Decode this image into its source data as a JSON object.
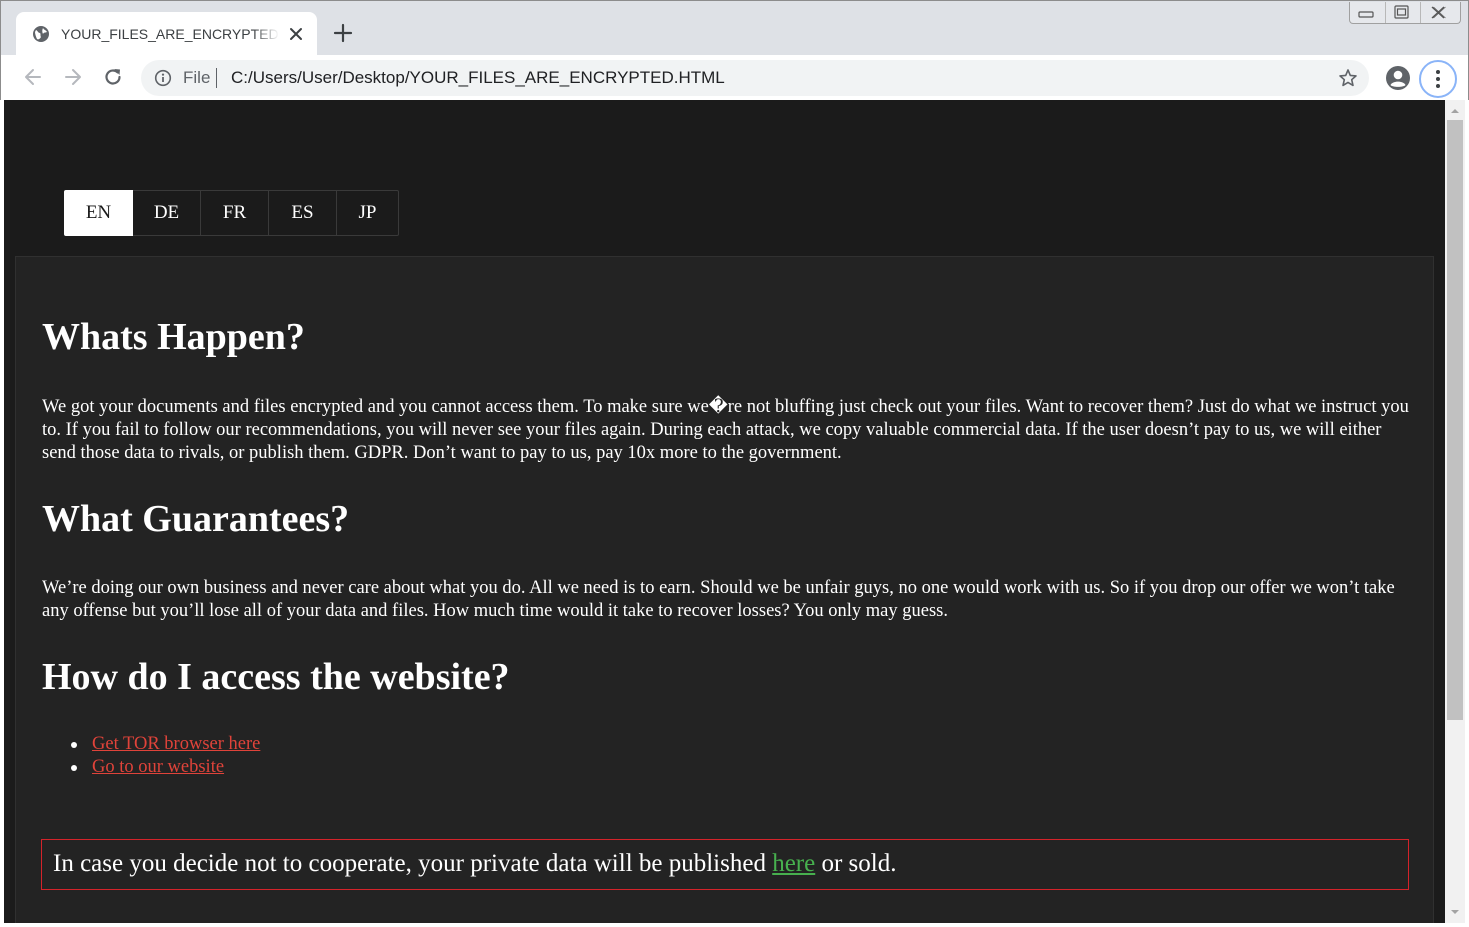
{
  "browser": {
    "tab": {
      "title": "YOUR_FILES_ARE_ENCRYPTED.HTML",
      "favicon": "globe-icon",
      "close_icon": "close-icon"
    },
    "new_tab_icon": "plus-icon",
    "window_controls": [
      "minimize-icon",
      "restore-icon",
      "close-icon"
    ],
    "nav": {
      "back_icon": "arrow-left-icon",
      "forward_icon": "arrow-right-icon",
      "reload_icon": "reload-icon"
    },
    "omnibox": {
      "scheme_label": "File",
      "url": "C:/Users/User/Desktop/YOUR_FILES_ARE_ENCRYPTED.HTML",
      "info_icon": "info-icon",
      "bookmark_icon": "star-icon"
    },
    "profile_icon": "account-circle-icon",
    "menu_icon": "kebab-menu-icon",
    "accent": "#8ab4f8"
  },
  "page": {
    "languages": [
      {
        "label": "EN",
        "active": true
      },
      {
        "label": "DE",
        "active": false
      },
      {
        "label": "FR",
        "active": false
      },
      {
        "label": "ES",
        "active": false
      },
      {
        "label": "JP",
        "active": false
      }
    ],
    "sections": [
      {
        "heading": "Whats Happen?",
        "body": "We got your documents and files encrypted and you cannot access them. To make sure we�re not bluffing just check out your files. Want to recover them? Just do what we instruct you to. If you fail to follow our recommendations, you will never see your files again. During each attack, we copy valuable commercial data. If the user doesn’t pay to us, we will either send those data to rivals, or publish them. GDPR. Don’t want to pay to us, pay 10x more to the government."
      },
      {
        "heading": "What Guarantees?",
        "body": "We’re doing our own business and never care about what you do. All we need is to earn. Should we be unfair guys, no one would work with us. So if you drop our offer we won’t take any offense but you’ll lose all of your data and files. How much time would it take to recover losses? You only may guess."
      },
      {
        "heading": "How do I access the website?"
      }
    ],
    "links": [
      {
        "label": "Get TOR browser here"
      },
      {
        "label": "Go to our website"
      }
    ],
    "warning": {
      "before": "In case you decide not to cooperate, your private data will be published ",
      "link": "here",
      "after": " or sold."
    },
    "colors": {
      "background": "#1b1b1b",
      "panel": "#232323",
      "link": "#e0433a",
      "warning_border": "#d4232a",
      "warning_link": "#47b04e"
    }
  }
}
